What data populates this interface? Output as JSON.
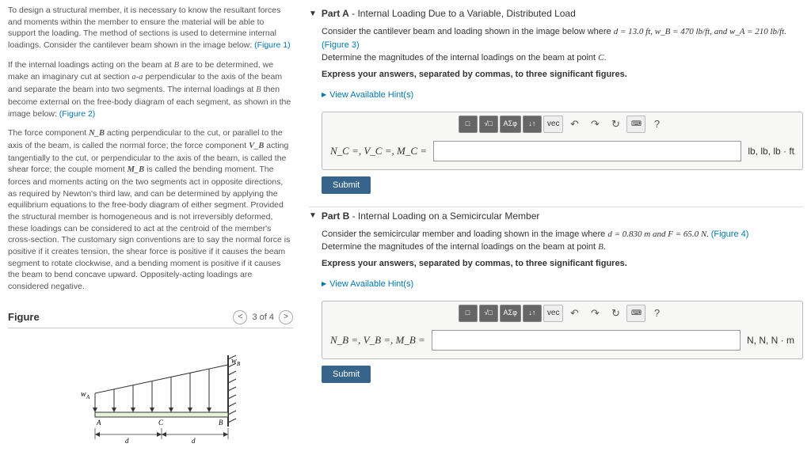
{
  "intro": {
    "p1a": "To design a structural member, it is necessary to know the resultant forces and moments within the member to ensure the material will be able to support the loading. The method of sections is used to determine internal loadings. Consider the cantilever beam shown in the image below: ",
    "p1link": "(Figure 1)",
    "p2a": "If the internal loadings acting on the beam at ",
    "p2b": " are to be determined, we make an imaginary cut at section ",
    "p2c": " perpendicular to the axis of the beam and separate the beam into two segments. The internal loadings at ",
    "p2d": " then become external on the free-body diagram of each segment, as shown in the image below: ",
    "p2link": "(Figure 2)",
    "B": "B",
    "aa": "a-a",
    "p3a": "The force component ",
    "NB": "N_B",
    "p3b": " acting perpendicular to the cut, or parallel to the axis of the beam, is called the normal force; the force component ",
    "VB": "V_B",
    "p3c": " acting tangentially to the cut, or perpendicular to the axis of the beam, is called the shear force; the couple moment ",
    "MB": "M_B",
    "p3d": " is called the bending moment. The forces and moments acting on the two segments act in opposite directions, as required by Newton's third law, and can be determined by applying the equilibrium equations to the free-body diagram of either segment. Provided the structural member is homogeneous and is not irreversibly deformed, these loadings can be considered to act at the centroid of the member's cross-section. The customary sign conventions are to say the normal force is positive if it creates tension, the shear force is positive if it causes the beam segment to rotate clockwise, and a bending moment is positive if it causes the beam to bend concave upward. Oppositely-acting loadings are considered negative."
  },
  "figure": {
    "title": "Figure",
    "counter": "3 of 4",
    "labels": {
      "wA": "w_A",
      "wB": "w_B",
      "A": "A",
      "B": "B",
      "C": "C",
      "d": "d"
    }
  },
  "partA": {
    "title_prefix": "Part A",
    "title_rest": " - Internal Loading Due to a Variable, Distributed Load",
    "desc1": "Consider the cantilever beam and loading shown in the image below where ",
    "vals": "d = 13.0 ft, w_B = 470 lb/ft, and w_A = 210 lb/ft. ",
    "fig_link": "(Figure 3)",
    "desc2": "Determine the magnitudes of the internal loadings on the beam at point ",
    "pointC": "C",
    "period": ".",
    "instr": "Express your answers, separated by commas, to three significant figures.",
    "hint": "View Available Hint(s)",
    "ans_label": "N_C =, V_C =, M_C =",
    "units": "lb, lb, lb · ft",
    "submit": "Submit"
  },
  "partB": {
    "title_prefix": "Part B",
    "title_rest": " - Internal Loading on a Semicircular Member",
    "desc1": "Consider the semicircular member and loading shown in the image where ",
    "vals": "d = 0.830 m and F = 65.0 N. ",
    "fig_link": "(Figure 4)",
    "desc2": "Determine the magnitudes of the internal loadings on the beam at point ",
    "pointB": "B",
    "period": ".",
    "instr": "Express your answers, separated by commas, to three significant figures.",
    "hint": "View Available Hint(s)",
    "ans_label": "N_B =, V_B =, M_B =",
    "units": "N, N, N · m",
    "submit": "Submit"
  },
  "toolbar": {
    "templates": "□",
    "sqrt": "√□",
    "greek": "ΑΣφ",
    "arrows": "↓↑",
    "vec": "vec",
    "undo": "↶",
    "redo": "↷",
    "reset": "↻",
    "keyboard": "⌨",
    "help": "?"
  }
}
